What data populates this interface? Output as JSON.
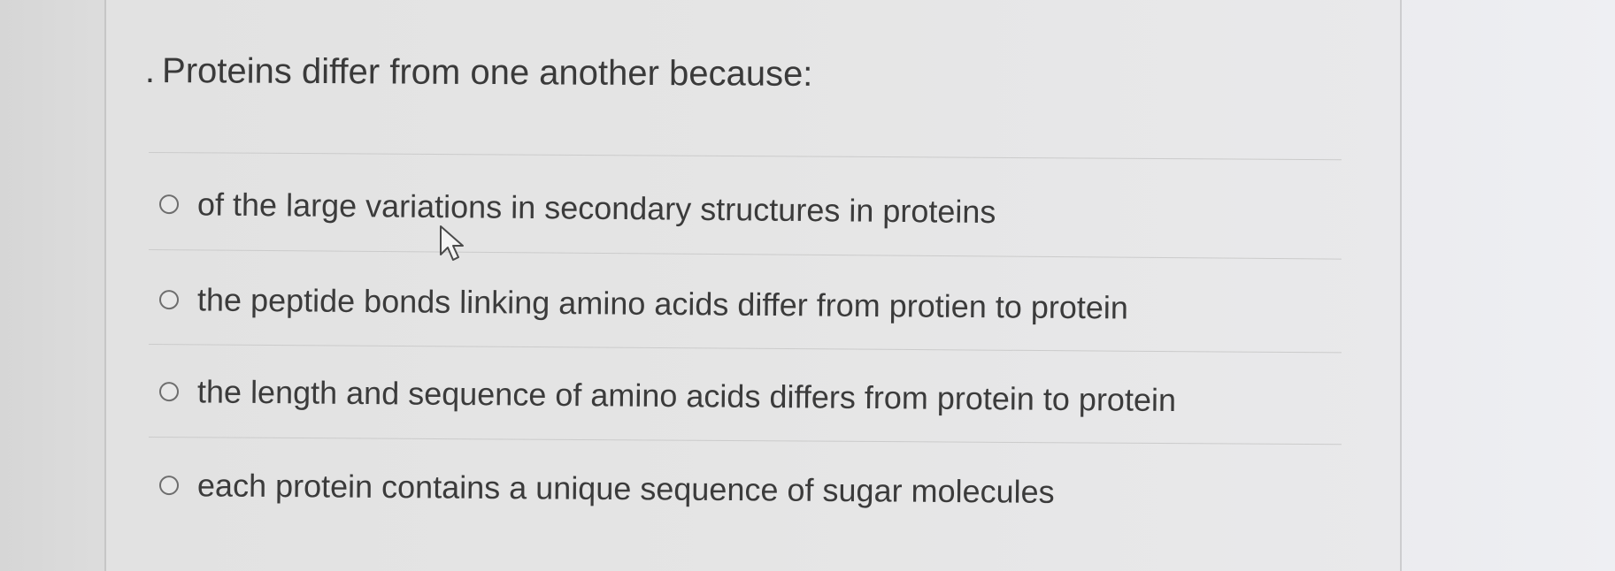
{
  "question": {
    "prefix": ".",
    "text": "Proteins differ from one another because:"
  },
  "options": [
    {
      "label": "of the large variations in secondary structures in proteins",
      "selected": false
    },
    {
      "label": "the peptide bonds linking amino acids differ from protien to protein",
      "selected": false
    },
    {
      "label": "the length and sequence of amino acids differs from protein to protein",
      "selected": false
    },
    {
      "label": "each protein contains a unique sequence of sugar molecules",
      "selected": false
    }
  ],
  "icons": {
    "radio": "radio-circle-icon",
    "cursor": "mouse-pointer-icon"
  }
}
